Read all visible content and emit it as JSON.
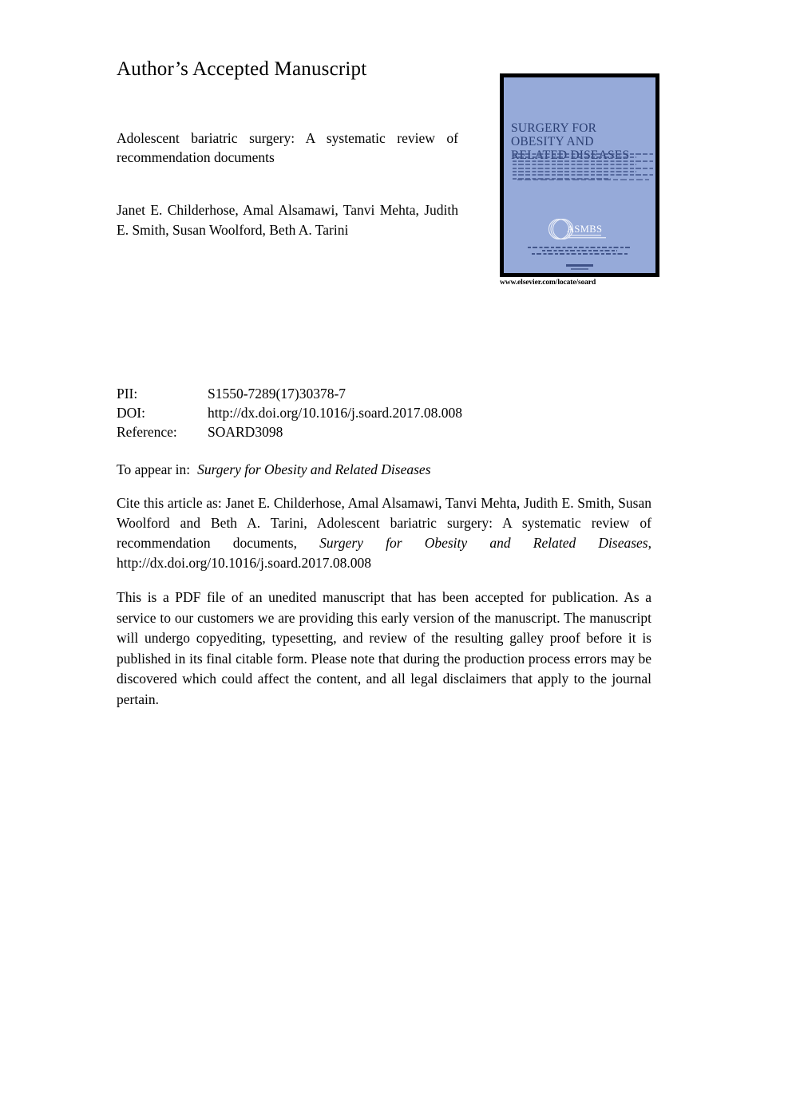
{
  "header": {
    "aam_label": "Author’s Accepted Manuscript"
  },
  "article": {
    "title": "Adolescent bariatric surgery: A systematic review of recommendation documents",
    "authors": "Janet E. Childerhose, Amal Alsamawi, Tanvi Mehta, Judith E. Smith, Susan Woolford, Beth A. Tarini"
  },
  "cover": {
    "journal_title": "SURGERY FOR OBESITY AND RELATED DISEASES",
    "society_logo": "ASMBS",
    "society_logo_tagline": "American Society for Metabolic & Bariatric Surgery",
    "publisher_url": "www.elsevier.com/locate/soard"
  },
  "metadata": {
    "rows": [
      {
        "label": "PII:",
        "value": "S1550-7289(17)30378-7"
      },
      {
        "label": "DOI:",
        "value": "http://dx.doi.org/10.1016/j.soard.2017.08.008"
      },
      {
        "label": "Reference:",
        "value": "SOARD3098"
      }
    ]
  },
  "appear": {
    "label": "To appear in:",
    "journal": "Surgery for Obesity and Related Diseases"
  },
  "citation": {
    "lead": "Cite this article as: Janet E. Childerhose, Amal Alsamawi, Tanvi Mehta, Judith E. Smith, Susan Woolford and Beth A. Tarini, Adolescent bariatric surgery: A systematic review of recommendation documents, ",
    "journal_italic": "Surgery for Obesity and Related Diseases",
    "tail": ", http://dx.doi.org/10.1016/j.soard.2017.08.008"
  },
  "disclaimer": {
    "text": "This is a PDF file of an unedited manuscript that has been accepted for publication. As a service to our customers we are providing this early version of the manuscript. The manuscript will undergo copyediting, typesetting, and review of the resulting galley proof before it is published in its final citable form. Please note that during the production process errors may be discovered which could affect the content, and all legal disclaimers that apply to the journal pertain."
  },
  "colors": {
    "cover_background": "#96aad9",
    "cover_border": "#000000",
    "cover_title_text": "#2b3f73",
    "page_background": "#ffffff",
    "body_text": "#000000"
  }
}
